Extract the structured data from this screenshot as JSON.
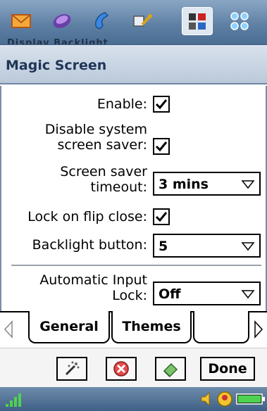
{
  "launcher": {
    "icons": [
      "mail-icon",
      "contacts-icon",
      "phone-icon",
      "tools-icon",
      "control-panel-icon",
      "apps-grid-icon"
    ],
    "peek_text": "Display  Backlight"
  },
  "window": {
    "title": "Magic Screen"
  },
  "form": {
    "enable_label": "Enable:",
    "enable_checked": true,
    "disable_saver_label_1": "Disable system",
    "disable_saver_label_2": "screen saver:",
    "disable_saver_checked": true,
    "timeout_label_1": "Screen saver",
    "timeout_label_2": "timeout:",
    "timeout_value": "3 mins",
    "lock_flip_label": "Lock on flip close:",
    "lock_flip_checked": true,
    "backlight_label": "Backlight button:",
    "backlight_value": "5",
    "auto_lock_label_1": "Automatic Input",
    "auto_lock_label_2": "Lock:",
    "auto_lock_value": "Off"
  },
  "tabs": [
    {
      "label": "General",
      "active": true
    },
    {
      "label": "Themes",
      "active": false
    }
  ],
  "buttons": {
    "done_label": "Done",
    "icons": [
      "magic-wand-icon",
      "close-circle-icon",
      "eraser-icon"
    ]
  },
  "status": {
    "icons": [
      "signal-icon",
      "volume-icon",
      "profile-icon",
      "battery-icon"
    ]
  },
  "colors": {
    "accent": "#1f3557",
    "titlebar": "#c9d5e3",
    "launcher": "#5c7ea3"
  }
}
